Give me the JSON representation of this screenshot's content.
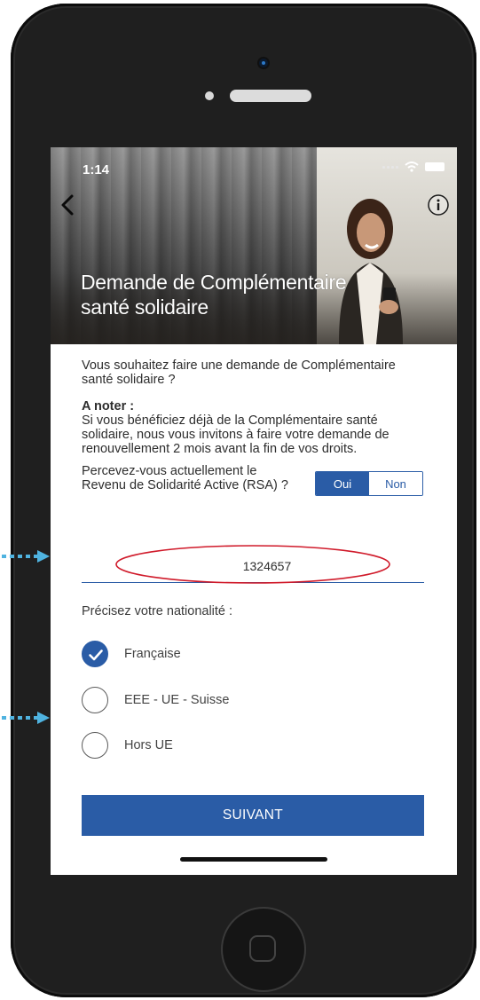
{
  "status_bar": {
    "time": "1:14"
  },
  "header": {
    "title_line1": "Demande de Complémentaire",
    "title_line2": "santé solidaire"
  },
  "content": {
    "intro": "Vous souhaitez faire une demande de Complémentaire santé solidaire ?",
    "note_title": "A noter :",
    "note_text": "Si  vous bénéficiez déjà de la Complémentaire santé solidaire, nous vous invitons à faire votre demande de renouvellement 2 mois avant la fin de vos droits.",
    "rsa_question": "Percevez-vous actuellement le Revenu de Solidarité Active (RSA) ?",
    "toggle": {
      "yes": "Oui",
      "no": "Non",
      "selected": "Oui"
    },
    "rsa_number": "1324657",
    "nationality_label": "Précisez votre nationalité :",
    "nationality_options": [
      {
        "label": "Française",
        "checked": true
      },
      {
        "label": "EEE - UE - Suisse",
        "checked": false
      },
      {
        "label": "Hors UE",
        "checked": false
      }
    ],
    "next_button": "SUIVANT"
  },
  "colors": {
    "primary": "#2a5ca6",
    "annotation_ellipse": "#d01a2a",
    "annotation_arrow": "#4fb3e0"
  },
  "icons": [
    "back-chevron-icon",
    "info-icon",
    "check-icon",
    "wifi-icon",
    "battery-icon"
  ]
}
